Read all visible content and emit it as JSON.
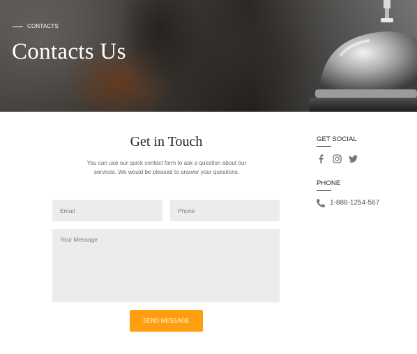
{
  "hero": {
    "breadcrumb": "CONTACTS",
    "title": "Contacts Us"
  },
  "form": {
    "title": "Get in Touch",
    "description": "You can use our quick contact form to ask a question about our services. We would be pleased to answer your questions.",
    "email_placeholder": "Email",
    "phone_placeholder": "Phone",
    "message_placeholder": "Your Message",
    "send_label": "SEND MESSAGE"
  },
  "sidebar": {
    "social_heading": "GET SOCIAL",
    "social_icons": [
      "facebook-icon",
      "instagram-icon",
      "twitter-icon"
    ],
    "phone_heading": "PHONE",
    "phone_number": "1-888-1254-567"
  },
  "colors": {
    "accent": "#ff9f0f",
    "field_bg": "#ececec",
    "icon": "#777777"
  }
}
